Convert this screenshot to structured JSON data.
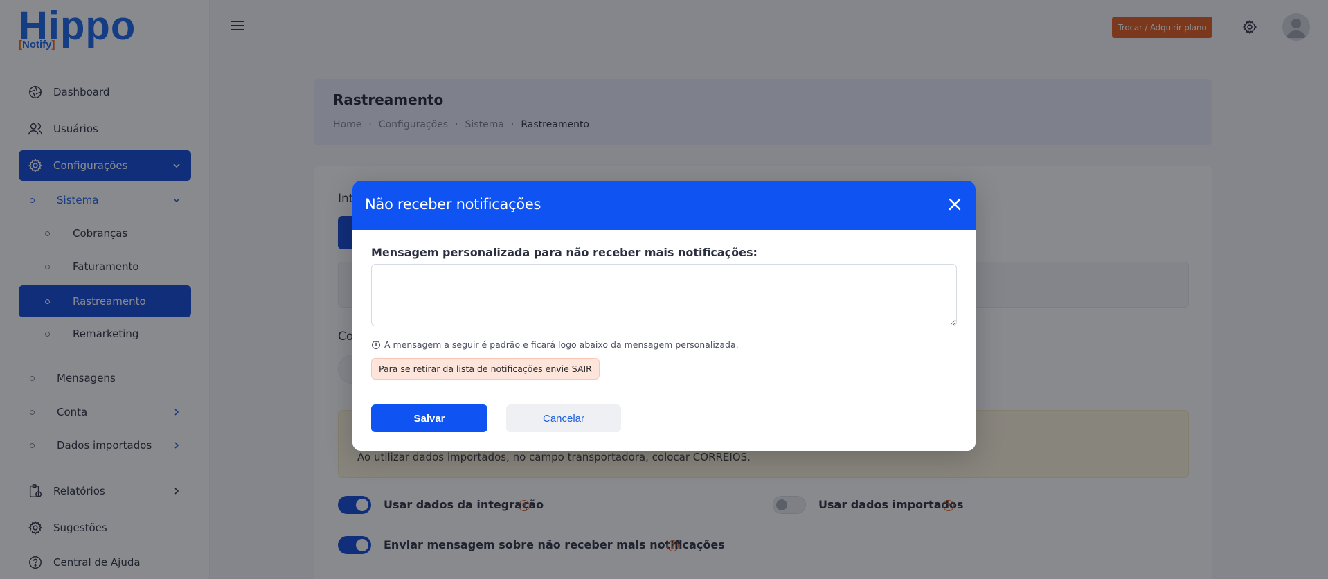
{
  "brand": {
    "name": "Hippo",
    "sub": "Notify"
  },
  "header": {
    "upgrade_label": "Trocar / Adquirir plano"
  },
  "sidebar": {
    "items": [
      {
        "label": "Dashboard"
      },
      {
        "label": "Usuários"
      },
      {
        "label": "Configurações"
      },
      {
        "label": "Sistema"
      },
      {
        "label": "Cobranças"
      },
      {
        "label": "Faturamento"
      },
      {
        "label": "Rastreamento"
      },
      {
        "label": "Remarketing"
      },
      {
        "label": "Mensagens"
      },
      {
        "label": "Conta"
      },
      {
        "label": "Dados importados"
      },
      {
        "label": "Relatórios"
      },
      {
        "label": "Sugestões"
      },
      {
        "label": "Central de Ajuda"
      }
    ]
  },
  "page": {
    "title": "Rastreamento",
    "breadcrumb": [
      "Home",
      "Configurações",
      "Sistema",
      "Rastreamento"
    ],
    "label_int": "Int",
    "label_co": "Co",
    "warning_text": "Ao utilizar dados importados, no campo transportadora, colocar CORREIOS.",
    "toggles": [
      {
        "label": "Usar dados da integração"
      },
      {
        "label": "Usar dados importados"
      },
      {
        "label": "Enviar mensagem sobre não receber mais notificações"
      }
    ]
  },
  "modal": {
    "title": "Não receber notificações",
    "field_label": "Mensagem personalizada para não receber mais notificações:",
    "textarea_value": "",
    "info_text": "A mensagem a seguir é padrão e ficará logo abaixo da mensagem personalizada.",
    "default_message": "Para se retirar da lista de notificações envie SAIR",
    "save_label": "Salvar",
    "cancel_label": "Cancelar"
  },
  "colors": {
    "primary": "#0f54f2",
    "sidebar_active": "#0f46d6",
    "accent_orange": "#e35a1a"
  }
}
